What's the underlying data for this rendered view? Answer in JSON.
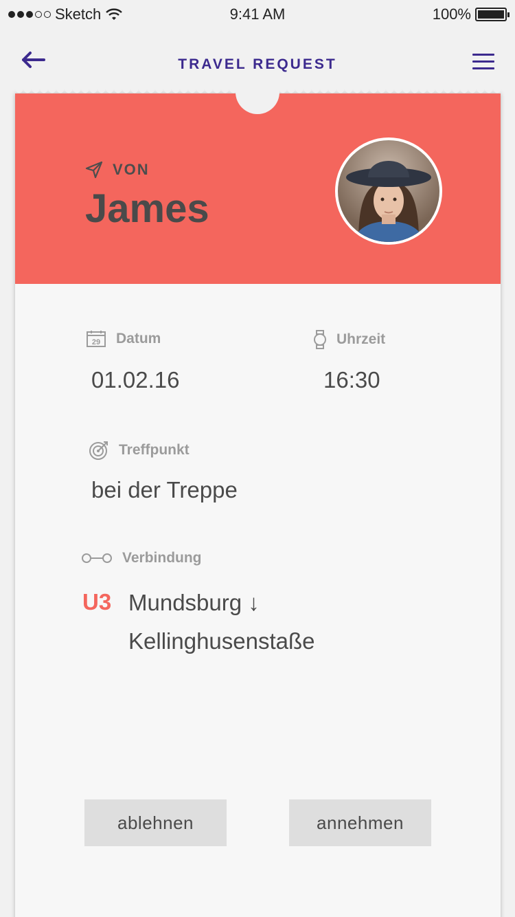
{
  "status_bar": {
    "carrier": "Sketch",
    "time": "9:41 AM",
    "battery": "100%"
  },
  "nav": {
    "title": "TRAVEL REQUEST",
    "back_icon": "arrow-left-icon",
    "menu_icon": "hamburger-menu-icon"
  },
  "sender": {
    "from_label": "VON",
    "name": "James"
  },
  "details": {
    "date_label": "Datum",
    "date_value": "01.02.16",
    "time_label": "Uhrzeit",
    "time_value": "16:30",
    "meeting_label": "Treffpunkt",
    "meeting_value": "bei der Treppe",
    "connection_label": "Verbindung",
    "line": "U3",
    "route_from": "Mundsburg ↓",
    "route_to": "Kellinghusenstaße"
  },
  "actions": {
    "decline_label": "ablehnen",
    "accept_label": "annehmen"
  },
  "colors": {
    "accent": "#3c2a8e",
    "header": "#f4665d",
    "line": "#f4665d"
  }
}
